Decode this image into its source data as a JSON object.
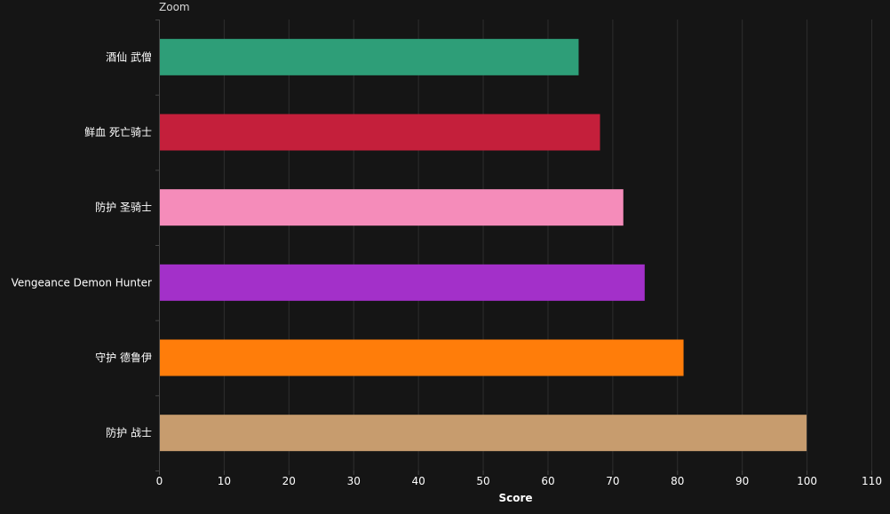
{
  "zoom_label": "Zoom",
  "chart_data": {
    "type": "bar",
    "orientation": "horizontal",
    "categories": [
      "酒仙 武僧",
      "鲜血 死亡骑士",
      "防护 圣骑士",
      "Vengeance Demon Hunter",
      "守护 德鲁伊",
      "防护 战士"
    ],
    "values": [
      64.8,
      68.1,
      71.7,
      75.0,
      81.0,
      100
    ],
    "colors": [
      "#2e9e78",
      "#c41f3b",
      "#f58cba",
      "#a330c9",
      "#ff7d0a",
      "#c79c6e"
    ],
    "xlabel": "Score",
    "ylabel": "",
    "xlim": [
      0,
      110
    ],
    "xticks": [
      0,
      10,
      20,
      30,
      40,
      50,
      60,
      70,
      80,
      90,
      100,
      110
    ],
    "grid": true,
    "legend": "none",
    "colors_theme": {
      "background": "#151515",
      "grid": "#2e2e2e",
      "axis": "#444444",
      "text": "#ffffff"
    }
  }
}
